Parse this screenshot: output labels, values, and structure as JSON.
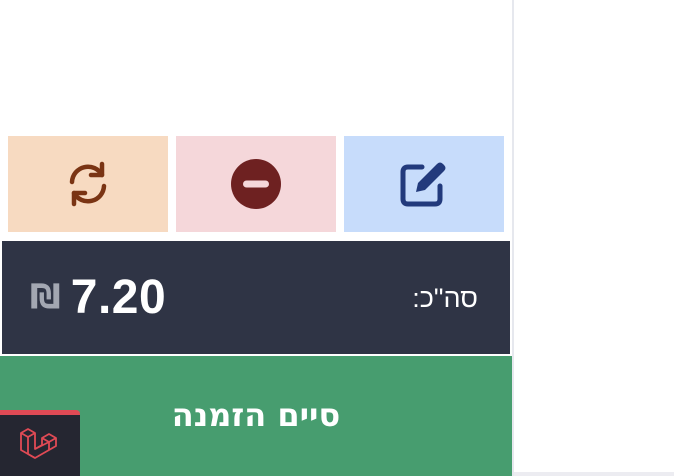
{
  "actions": {
    "refresh": {
      "icon": "refresh-icon",
      "color": "#7a3414",
      "background": "#f7dac1"
    },
    "remove": {
      "icon": "minus-circle-icon",
      "color": "#6e2121",
      "background": "#f5d7da"
    },
    "edit": {
      "icon": "edit-icon",
      "color": "#223a7c",
      "background": "#c7dcfb"
    }
  },
  "total": {
    "label": "סה\"כ:",
    "amount": "7.20",
    "currency_symbol": "₪"
  },
  "finish_order": {
    "label": "סיים הזמנה",
    "color": "#479d6f"
  },
  "dev_badge": {
    "icon": "laravel-logo-icon",
    "accent": "#e04a55"
  }
}
